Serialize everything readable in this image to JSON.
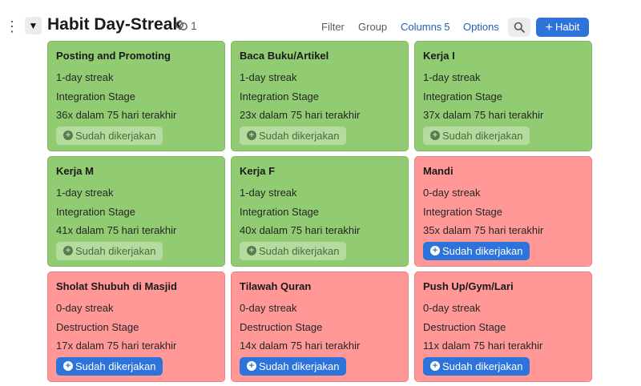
{
  "header": {
    "title": "Habit Day-Streak",
    "link_count": "1",
    "filter_label": "Filter",
    "group_label": "Group",
    "columns_label": "Columns",
    "columns_count": "5",
    "options_label": "Options",
    "new_label": "Habit"
  },
  "colors": {
    "green": "#91cc72",
    "red": "#ff9896",
    "accent": "#2e73d9"
  },
  "cards": [
    {
      "title": "Posting and Promoting",
      "streak": "1-day streak",
      "stage": "Integration Stage",
      "count": "36x dalam 75 hari terakhir",
      "button": "Sudah dikerjakan",
      "status": "green"
    },
    {
      "title": "Baca Buku/Artikel",
      "streak": "1-day streak",
      "stage": "Integration Stage",
      "count": "23x dalam 75 hari terakhir",
      "button": "Sudah dikerjakan",
      "status": "green"
    },
    {
      "title": "Kerja I",
      "streak": "1-day streak",
      "stage": "Integration Stage",
      "count": "37x dalam 75 hari terakhir",
      "button": "Sudah dikerjakan",
      "status": "green"
    },
    {
      "title": "Kerja M",
      "streak": "1-day streak",
      "stage": "Integration Stage",
      "count": "41x dalam 75 hari terakhir",
      "button": "Sudah dikerjakan",
      "status": "green"
    },
    {
      "title": "Kerja F",
      "streak": "1-day streak",
      "stage": "Integration Stage",
      "count": "40x dalam 75 hari terakhir",
      "button": "Sudah dikerjakan",
      "status": "green"
    },
    {
      "title": "Mandi",
      "streak": "0-day streak",
      "stage": "Integration Stage",
      "count": "35x dalam 75 hari terakhir",
      "button": "Sudah dikerjakan",
      "status": "red"
    },
    {
      "title": "Sholat Shubuh di Masjid",
      "streak": "0-day streak",
      "stage": "Destruction Stage",
      "count": "17x dalam 75 hari terakhir",
      "button": "Sudah dikerjakan",
      "status": "red"
    },
    {
      "title": "Tilawah Quran",
      "streak": "0-day streak",
      "stage": "Destruction Stage",
      "count": "14x dalam 75 hari terakhir",
      "button": "Sudah dikerjakan",
      "status": "red"
    },
    {
      "title": "Push Up/Gym/Lari",
      "streak": "0-day streak",
      "stage": "Destruction Stage",
      "count": "11x dalam 75 hari terakhir",
      "button": "Sudah dikerjakan",
      "status": "red"
    }
  ]
}
